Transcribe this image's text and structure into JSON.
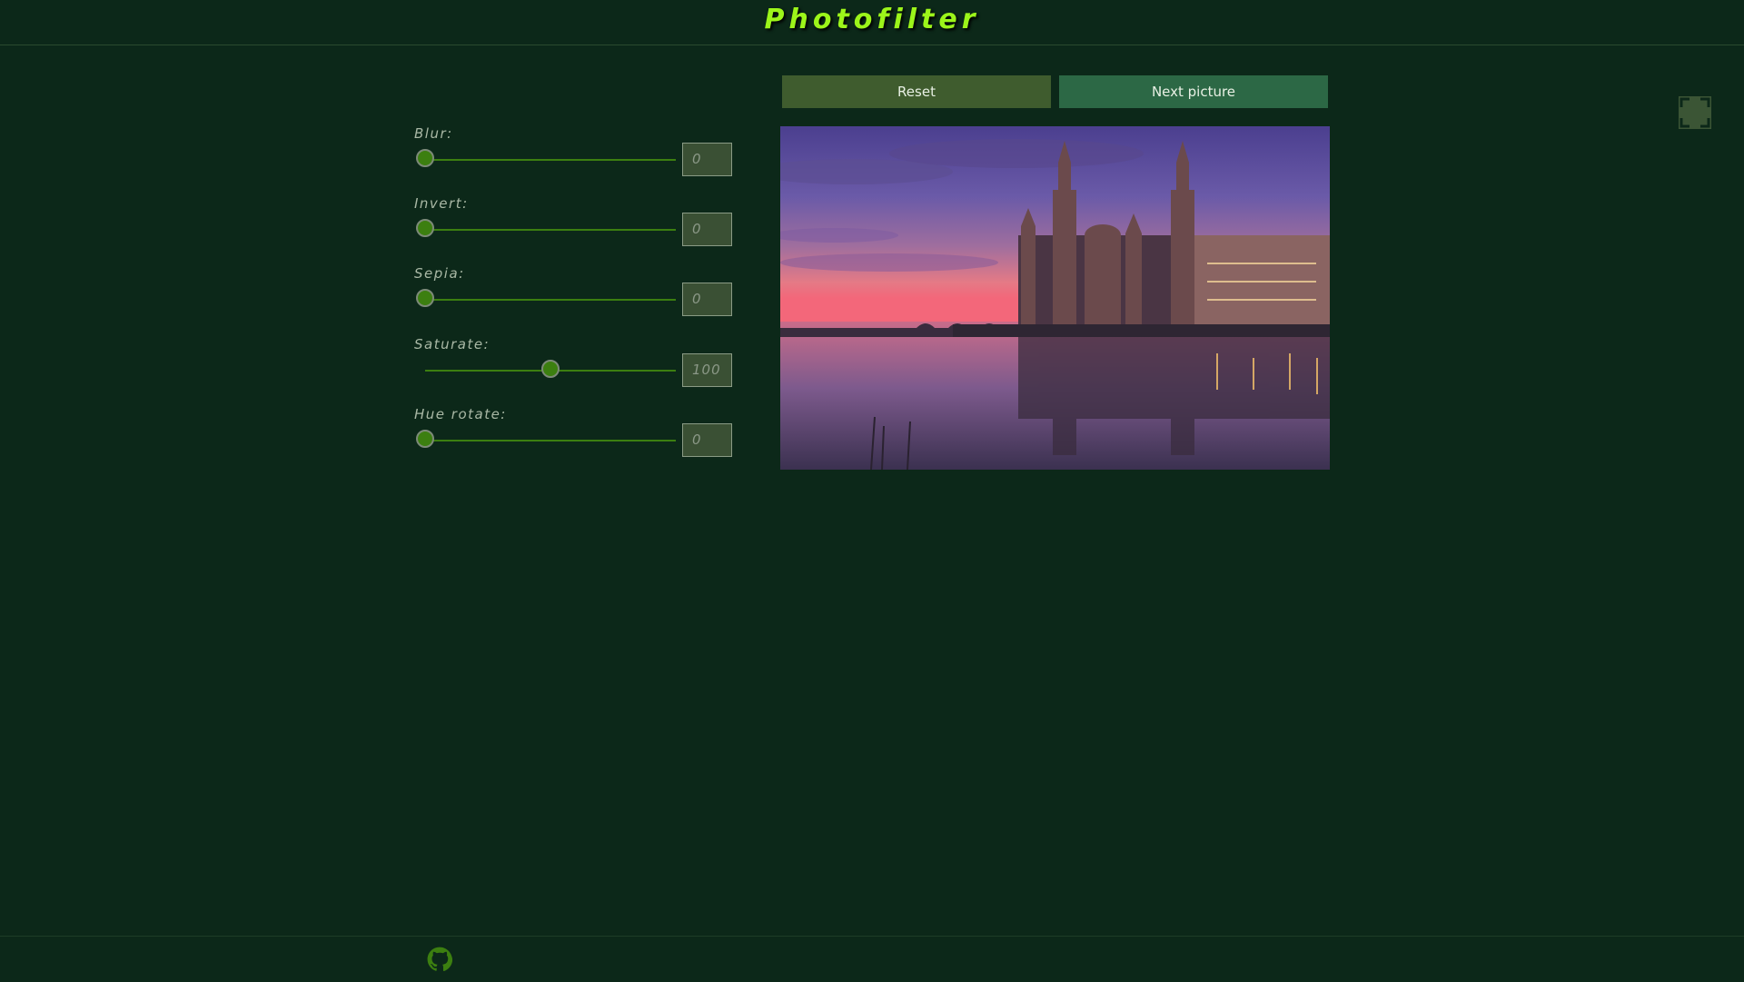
{
  "app": {
    "title": "Photofilter"
  },
  "toolbar": {
    "reset_label": "Reset",
    "next_label": "Next picture"
  },
  "filters": [
    {
      "label": "Blur:",
      "value": "0",
      "level": 0
    },
    {
      "label": "Invert:",
      "value": "0",
      "level": 0
    },
    {
      "label": "Sepia:",
      "value": "0",
      "level": 0
    },
    {
      "label": "Saturate:",
      "value": "100",
      "level": 0.5
    },
    {
      "label": "Hue rotate:",
      "value": "0",
      "level": 0
    }
  ],
  "icons": {
    "fullscreen": "fullscreen-icon",
    "github": "github-icon"
  },
  "colors": {
    "background": "#0c2819",
    "title": "#9cf51a",
    "accent": "#3c7f10",
    "reset_button": "#3f5c2e",
    "next_button": "#2c6845"
  }
}
